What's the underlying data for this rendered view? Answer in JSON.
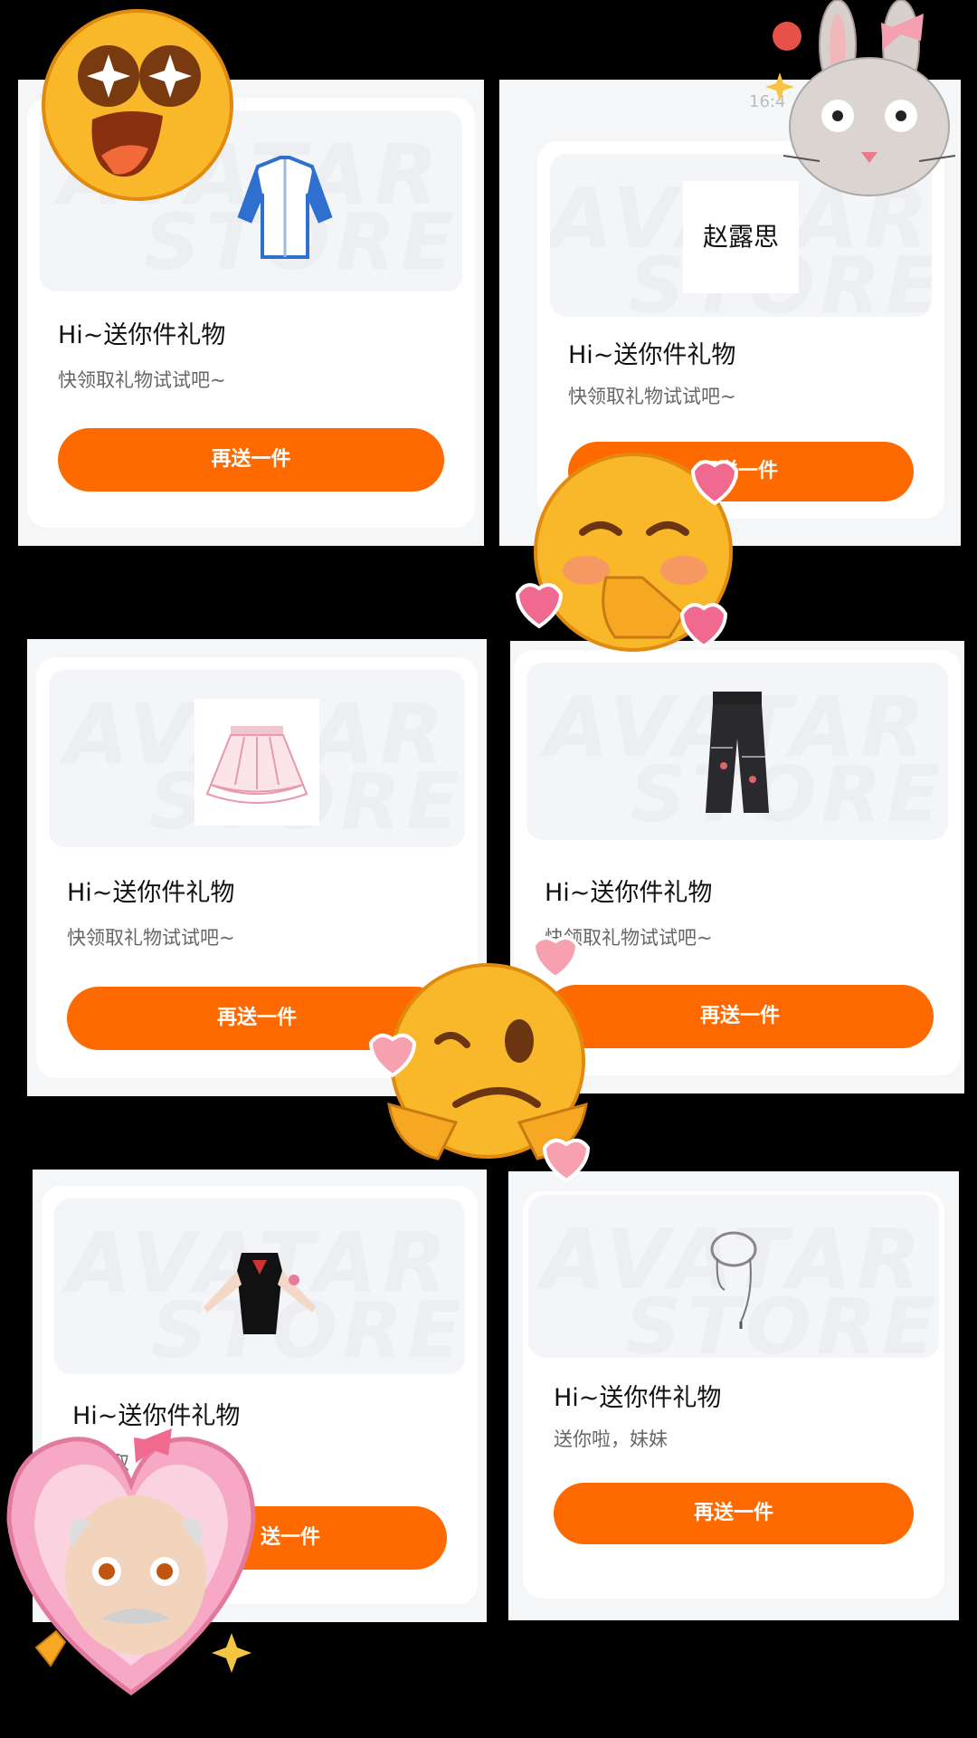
{
  "status": {
    "time": "16:4"
  },
  "cards": [
    {
      "title": "Hi~送你件礼物",
      "subtitle": "快领取礼物试试吧~",
      "button": "再送一件",
      "gift": "jacket-icon",
      "watermark_top": "AVATAR",
      "watermark_bottom": "STORE"
    },
    {
      "title": "Hi~送你件礼物",
      "subtitle": "快领取礼物试试吧~",
      "button": "再送一件",
      "gift": "name-card",
      "gift_text": "赵露思",
      "watermark_top": "AVATAR",
      "watermark_bottom": "STORE"
    },
    {
      "title": "Hi~送你件礼物",
      "subtitle": "快领取礼物试试吧~",
      "button": "再送一件",
      "gift": "skirt-icon",
      "watermark_top": "AVATAR",
      "watermark_bottom": "STORE"
    },
    {
      "title": "Hi~送你件礼物",
      "subtitle": "快领取礼物试试吧~",
      "button": "再送一件",
      "gift": "pants-icon",
      "watermark_top": "AVATAR",
      "watermark_bottom": "STORE"
    },
    {
      "title": "Hi~送你件礼物",
      "subtitle": "快领取",
      "button": "送一件",
      "gift": "top-icon",
      "watermark_top": "AVATAR",
      "watermark_bottom": "STORE"
    },
    {
      "title": "Hi~送你件礼物",
      "subtitle": "送你啦，妹妹",
      "button": "再送一件",
      "gift": "necklace-icon",
      "watermark_top": "AVATAR",
      "watermark_bottom": "STORE"
    }
  ],
  "colors": {
    "accent": "#ff6a00",
    "background": "#000000",
    "card": "#ffffff"
  },
  "stickers": [
    "star-struck-emoji",
    "bunny-face-sticker",
    "blushing-emoji",
    "woozy-emoji",
    "old-man-heart-sticker"
  ]
}
